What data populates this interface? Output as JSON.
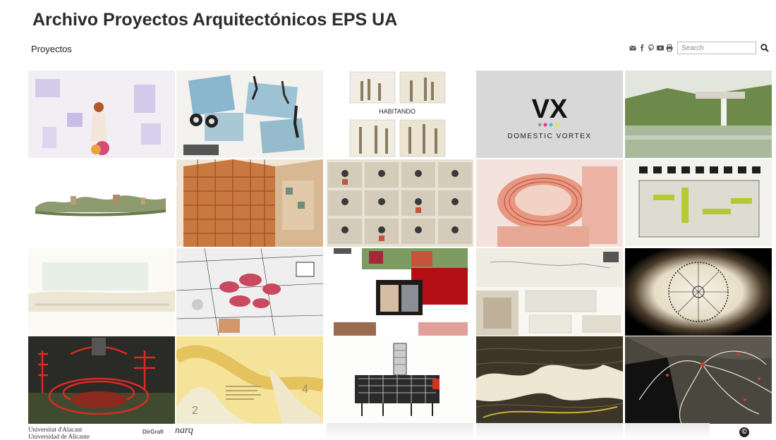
{
  "header": {
    "title": "Archivo Proyectos Arquitectónicos EPS UA",
    "section_link": "Proyectos"
  },
  "search": {
    "placeholder": "Search"
  },
  "social_icons": [
    "mail-icon",
    "facebook-icon",
    "pinterest-icon",
    "youtube-icon",
    "print-icon"
  ],
  "tiles": [
    {
      "label": ""
    },
    {
      "label": ""
    },
    {
      "label": "HABITANDO"
    },
    {
      "label": "DOMESTIC VORTEX",
      "logo": "VX"
    },
    {
      "label": ""
    },
    {
      "label": ""
    },
    {
      "label": ""
    },
    {
      "label": ""
    },
    {
      "label": ""
    },
    {
      "label": ""
    },
    {
      "label": ""
    },
    {
      "label": ""
    },
    {
      "label": ""
    },
    {
      "label": ""
    },
    {
      "label": ""
    },
    {
      "label": ""
    },
    {
      "label": "2"
    },
    {
      "label": ""
    },
    {
      "label": ""
    },
    {
      "label": ""
    }
  ],
  "tile_extra": {
    "number_right": "4"
  },
  "footer": {
    "ua_line1": "Universitat d'Alacant",
    "ua_line2": "Universidad de Alicante",
    "dept": "DirGrafi",
    "nar": "narq",
    "copyright": "©"
  }
}
